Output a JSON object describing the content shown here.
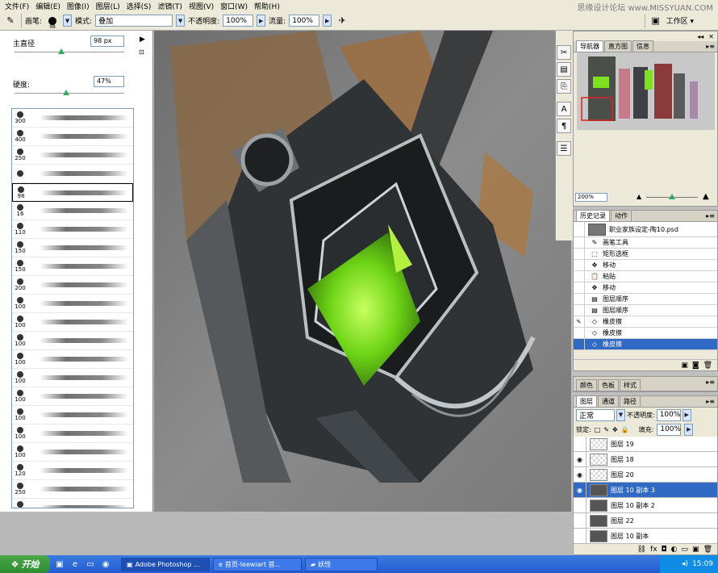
{
  "menu": [
    "文件(F)",
    "编辑(E)",
    "图像(I)",
    "图层(L)",
    "选择(S)",
    "滤镜(T)",
    "视图(V)",
    "窗口(W)",
    "帮助(H)"
  ],
  "watermark": "思缘设计论坛 www.MISSYUAN.COM",
  "options": {
    "brush_label": "画笔:",
    "brush_size": "98",
    "mode_label": "模式:",
    "mode_value": "叠加",
    "opacity_label": "不透明度:",
    "opacity_value": "100%",
    "flow_label": "流量:",
    "flow_value": "100%",
    "workspace_label": "工作区"
  },
  "brush_panel": {
    "diameter_label": "主直径",
    "diameter_value": "98 px",
    "hardness_label": "硬度:",
    "hardness_value": "47%",
    "diameter_fraction": 0.43,
    "hardness_fraction": 0.47,
    "presets": [
      "300",
      "400",
      "250",
      "",
      "98",
      "16",
      "110",
      "150",
      "150",
      "200",
      "100",
      "100",
      "100",
      "100",
      "100",
      "100",
      "100",
      "100",
      "100",
      "120",
      "250",
      "391"
    ],
    "selected_index": 4
  },
  "navigator": {
    "tabs": [
      "导航器",
      "直方图",
      "信息"
    ],
    "zoom": "200%"
  },
  "history": {
    "tabs": [
      "历史记录",
      "动作"
    ],
    "snapshot": "职业家族设定-陶10.psd",
    "items": [
      {
        "label": "画笔工具",
        "icon": "brush-icon"
      },
      {
        "label": "矩形选框",
        "icon": "marquee-icon"
      },
      {
        "label": "移动",
        "icon": "move-icon"
      },
      {
        "label": "粘贴",
        "icon": "paste-icon"
      },
      {
        "label": "移动",
        "icon": "move-icon"
      },
      {
        "label": "图层顺序",
        "icon": "layer-order-icon"
      },
      {
        "label": "图层顺序",
        "icon": "layer-order-icon"
      },
      {
        "label": "橡皮擦",
        "icon": "eraser-icon"
      },
      {
        "label": "橡皮擦",
        "icon": "eraser-icon"
      },
      {
        "label": "橡皮擦",
        "icon": "eraser-icon"
      }
    ],
    "selected_index": 9
  },
  "color_tabs": [
    "颜色",
    "色板",
    "样式"
  ],
  "layers": {
    "tabs": [
      "图层",
      "通道",
      "路径"
    ],
    "blend_mode": "正常",
    "opacity_label": "不透明度:",
    "opacity_value": "100%",
    "lock_label": "锁定:",
    "fill_label": "填充:",
    "fill_value": "100%",
    "items": [
      {
        "name": "图层 19",
        "visible": false,
        "thumb": "light"
      },
      {
        "name": "图层 18",
        "visible": true,
        "thumb": "light"
      },
      {
        "name": "图层 20",
        "visible": true,
        "thumb": "light"
      },
      {
        "name": "图层 10 副本 3",
        "visible": true,
        "thumb": "dark"
      },
      {
        "name": "图层 10 副本 2",
        "visible": false,
        "thumb": "dark"
      },
      {
        "name": "图层 22",
        "visible": false,
        "thumb": "dark"
      },
      {
        "name": "图层 10 副本",
        "visible": false,
        "thumb": "dark"
      }
    ],
    "selected_index": 3
  },
  "taskbar": {
    "start": "开始",
    "tasks": [
      "Adobe Photoshop ...",
      "首页-leewiart 首...",
      "妖怪"
    ],
    "active_index": 0,
    "clock": "15:09"
  },
  "colors": {
    "selection": "#316ac5",
    "glow": "#7fe020",
    "taskbar": "#245dd0"
  }
}
